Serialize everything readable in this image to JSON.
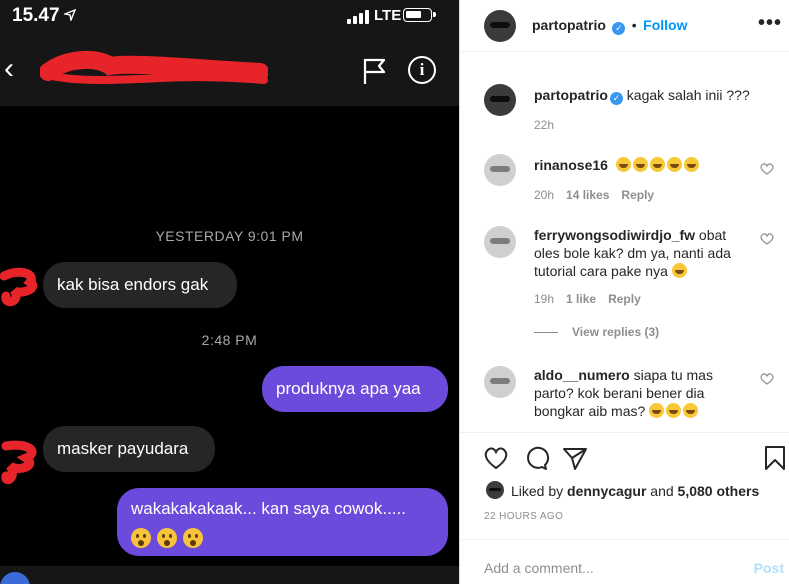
{
  "chat": {
    "status": {
      "time": "15.47",
      "network": "LTE"
    },
    "timestamps": [
      "YESTERDAY 9:01 PM",
      "2:48 PM"
    ],
    "messages": [
      {
        "from": "them",
        "text": "kak bisa endors gak"
      },
      {
        "from": "me",
        "text": "produknya apa yaa"
      },
      {
        "from": "them",
        "text": "masker payudara"
      },
      {
        "from": "me",
        "text": "wakakakakaak... kan saya cowok....."
      }
    ],
    "colors": {
      "incoming": "#262626",
      "outgoing": "#6c4bdc",
      "redaction": "#e8242b"
    }
  },
  "post": {
    "header": {
      "username": "partopatrio",
      "separator": "•",
      "follow": "Follow",
      "more": "•••"
    },
    "caption": {
      "username": "partopatrio",
      "text": "kagak salah inii ???",
      "time": "22h"
    },
    "comments": [
      {
        "username": "rinanose16",
        "text": "",
        "time": "20h",
        "likes": "14 likes",
        "reply": "Reply"
      },
      {
        "username": "ferrywongsodiwirdjo_fw",
        "text": "obat oles bole kak? dm ya, nanti ada tutorial cara pake nya",
        "time": "19h",
        "likes": "1 like",
        "reply": "Reply",
        "view_replies": "View replies (3)"
      },
      {
        "username": "aldo__numero",
        "text": "siapa tu mas parto? kok berani bener dia bongkar aib mas?"
      }
    ],
    "liked_by": {
      "prefix": "Liked by",
      "user": "dennycagur",
      "and": "and",
      "others": "5,080 others"
    },
    "posted_ago": "22 HOURS AGO",
    "add_comment": {
      "placeholder": "Add a comment...",
      "post": "Post"
    },
    "colors": {
      "accent": "#0095f6",
      "verified": "#3897f0"
    }
  }
}
